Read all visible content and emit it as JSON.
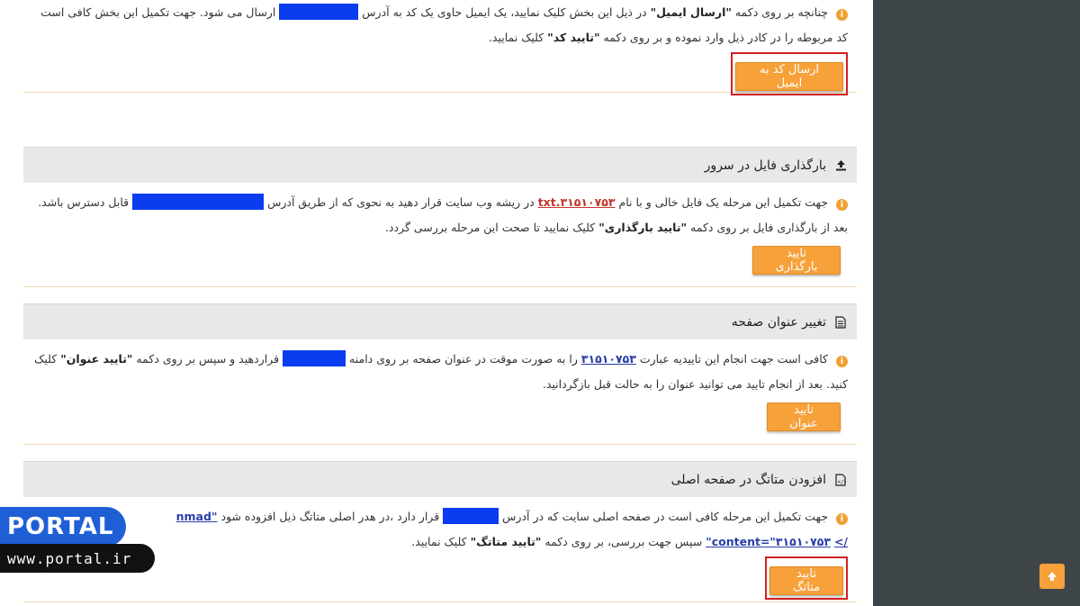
{
  "email_section": {
    "line1_a": "چنانچه بر روی دکمه",
    "line1_b": "\"ارسال ایمیل\"",
    "line1_c": "در ذیل این بخش کلیک نمایید، یک ایمیل حاوی یک کد به آدرس",
    "line1_d": "ارسال می شود. جهت تکمیل این بخش کافی است",
    "line2_a": "کد مربوطه را در کادر ذیل وارد نموده و بر روی دکمه",
    "line2_b": "\"تایید کد\"",
    "line2_c": "کلیک نمایید.",
    "button": "ارسال کد به ایمیل"
  },
  "upload_section": {
    "title": "بارگذاری فایل در سرور",
    "line1_a": "جهت تکمیل این مرحله یک فایل خالی و با نام",
    "filename": "۳۱۵۱۰۷۵۳.txt",
    "line1_b": "در ریشه وب سایت قرار دهید به نحوی که از طریق آدرس",
    "line1_c": "قابل دسترس باشد.",
    "line2_a": "بعد از بارگذاری فایل بر روی دکمه",
    "line2_b": "\"تایید بارگذاری\"",
    "line2_c": "کلیک نمایید تا صحت این مرحله بررسی گردد.",
    "button": "تایید بارگذاری"
  },
  "title_section": {
    "title": "تغییر عنوان صفحه",
    "line1_a": "کافی است جهت انجام این تاییدیه عبارت",
    "code": "۳۱۵۱۰۷۵۳",
    "line1_b": "را به صورت موقت در عنوان صفحه بر روی دامنه",
    "line1_c": "قراردهید و سپس بر روی دکمه",
    "line1_d": "\"تایید عنوان\"",
    "line1_e": "کلیک",
    "line2": "کنید. بعد از انجام تایید می توانید عنوان را به حالت قبل بازگردانید.",
    "button": "تایید عنوان"
  },
  "meta_section": {
    "title": "افزودن متاتگ در صفحه اصلی",
    "line1_a": "جهت تکمیل این مرحله کافی است در صفحه اصلی سایت که در آدرس",
    "line1_b": "قرار دارد ،در هدر اصلی متاتگ ذیل افزوده شود",
    "meta_name": "\"nmad",
    "meta_content": "content=\"۳۱۵۱۰۷۵۳\"",
    "meta_close": "/>",
    "line2": "سپس جهت بررسی، بر روی دکمه",
    "line2_b": "\"تایید متاتگ\"",
    "line2_c": "کلیک نمایید.",
    "button": "تایید متاتگ"
  },
  "watermark": {
    "brand": "PORTAL",
    "url": "www.portal.ir"
  },
  "scroll_top_icon": "arrow-up-icon"
}
